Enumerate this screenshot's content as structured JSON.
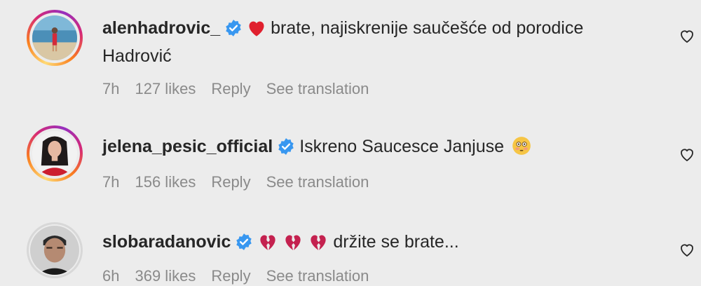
{
  "comments": [
    {
      "username": "alenhadrovic_",
      "verified": true,
      "emojis": [
        "red-heart"
      ],
      "text": "brate, najiskrenije saučešće od porodice Hadrović",
      "text_line1": "brate, najiskrenije saučešće od porodice",
      "text_line2": "Hadrović",
      "time": "7h",
      "likes": "127 likes",
      "reply": "Reply",
      "translate": "See translation"
    },
    {
      "username": "jelena_pesic_official",
      "verified": true,
      "emojis_after": [
        "flushed-face"
      ],
      "text": "Iskreno Saucesce Janjuse",
      "time": "7h",
      "likes": "156 likes",
      "reply": "Reply",
      "translate": "See translation"
    },
    {
      "username": "slobaradanovic",
      "verified": true,
      "emojis": [
        "broken-heart",
        "broken-heart",
        "broken-heart"
      ],
      "text": "držite se brate...",
      "time": "6h",
      "likes": "369 likes",
      "reply": "Reply",
      "translate": "See translation"
    }
  ],
  "colors": {
    "background": "#ececec",
    "text": "#262626",
    "meta": "#8a8a8a",
    "verified": "#3897f0",
    "red_heart": "#e0202e",
    "broken_heart": "#c4214f"
  }
}
